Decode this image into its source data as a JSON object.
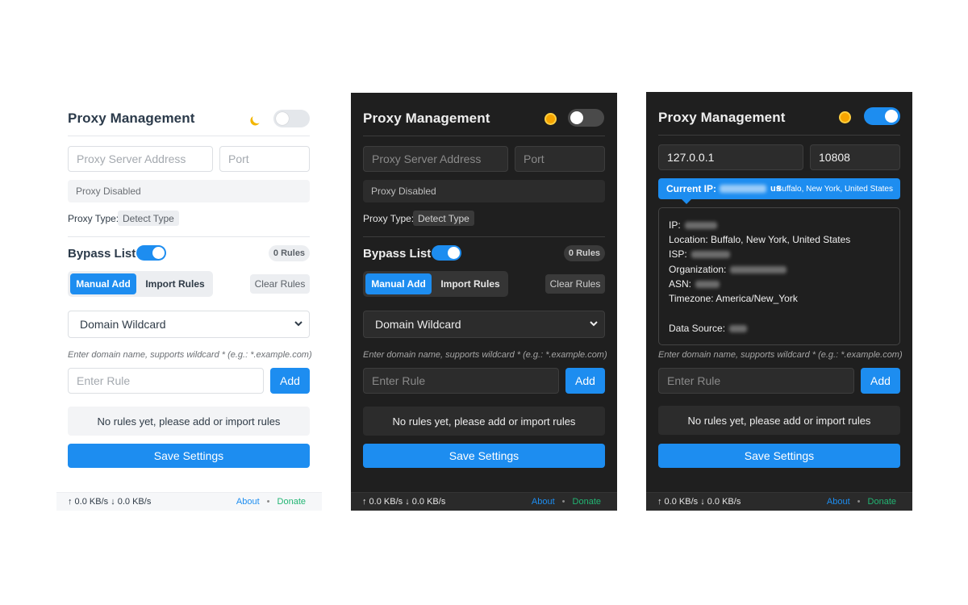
{
  "colors": {
    "accent": "#1d8df0",
    "donate": "#22b573",
    "dark_bg": "#1f1f1f",
    "light_bg": "#ffffff"
  },
  "common": {
    "title": "Proxy Management",
    "server_placeholder": "Proxy Server Address",
    "port_placeholder": "Port",
    "status_disabled": "Proxy Disabled",
    "proxy_type_label": "Proxy Type:",
    "proxy_type_value": "Detect Type",
    "bypass_title": "Bypass List",
    "rules_count": "0 Rules",
    "tab_manual": "Manual Add",
    "tab_import": "Import Rules",
    "clear_rules": "Clear Rules",
    "select_value": "Domain Wildcard",
    "hint": "Enter domain name, supports wildcard * (e.g.: *.example.com)",
    "rule_placeholder": "Enter Rule",
    "add_label": "Add",
    "empty_message": "No rules yet, please add or import rules",
    "save_label": "Save Settings",
    "speed": "↑ 0.0 KB/s ↓ 0.0 KB/s",
    "about": "About",
    "dot": "•",
    "donate": "Donate"
  },
  "panels": [
    {
      "theme": "light",
      "theme_icon": "moon-icon",
      "proxy_enabled": false
    },
    {
      "theme": "dark",
      "theme_icon": "sun-icon",
      "proxy_enabled": false
    },
    {
      "theme": "dark",
      "theme_icon": "sun-icon",
      "proxy_enabled": true
    }
  ],
  "active_panel": {
    "server_value": "127.0.0.1",
    "port_value": "10808",
    "current_ip_label": "Current IP:",
    "country_code": "us",
    "location_short": "Buffalo, New York, United States",
    "ip_label": "IP:",
    "location_line": "Location: Buffalo, New York, United States",
    "isp_label": "ISP:",
    "org_label": "Organization:",
    "asn_label": "ASN:",
    "timezone_line": "Timezone: America/New_York",
    "source_label": "Data Source:"
  }
}
